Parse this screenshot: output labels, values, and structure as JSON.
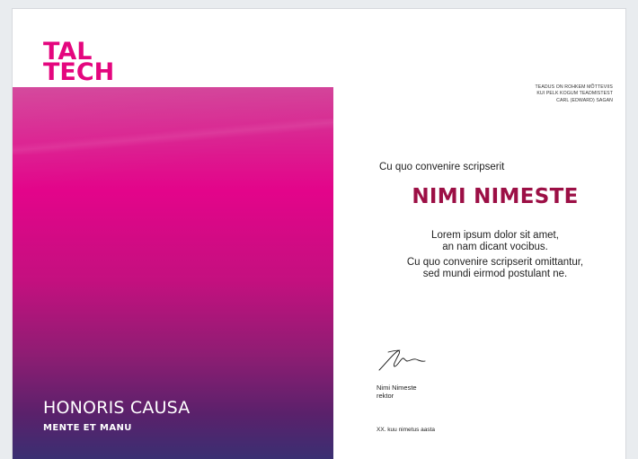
{
  "brand": {
    "logo_line1": "TAL",
    "logo_line2": "TECH",
    "accent_color": "#e4067e"
  },
  "quote": {
    "line1": "TEADUS ON ROHKEM MÕTTEVIIS",
    "line2": "KUI PELK KOGUM TEADMISTEST",
    "author": "CARL (EDWARD) SAGAN"
  },
  "certificate": {
    "intro": "Cu quo convenire scripserit",
    "name": "NIMI NIMESTE",
    "name_color": "#9c0f45",
    "paragraph1_line1": "Lorem ipsum dolor sit amet,",
    "paragraph1_line2": "an nam dicant vocibus.",
    "paragraph2_line1": "Cu quo convenire scripserit omittantur,",
    "paragraph2_line2": "sed mundi eirmod postulant ne."
  },
  "panel": {
    "title": "HONORIS CAUSA",
    "subtitle": "MENTE ET MANU"
  },
  "signer": {
    "name": "Nimi Nimeste",
    "role": "rektor"
  },
  "date_text": "XX. kuu nimetus aasta"
}
